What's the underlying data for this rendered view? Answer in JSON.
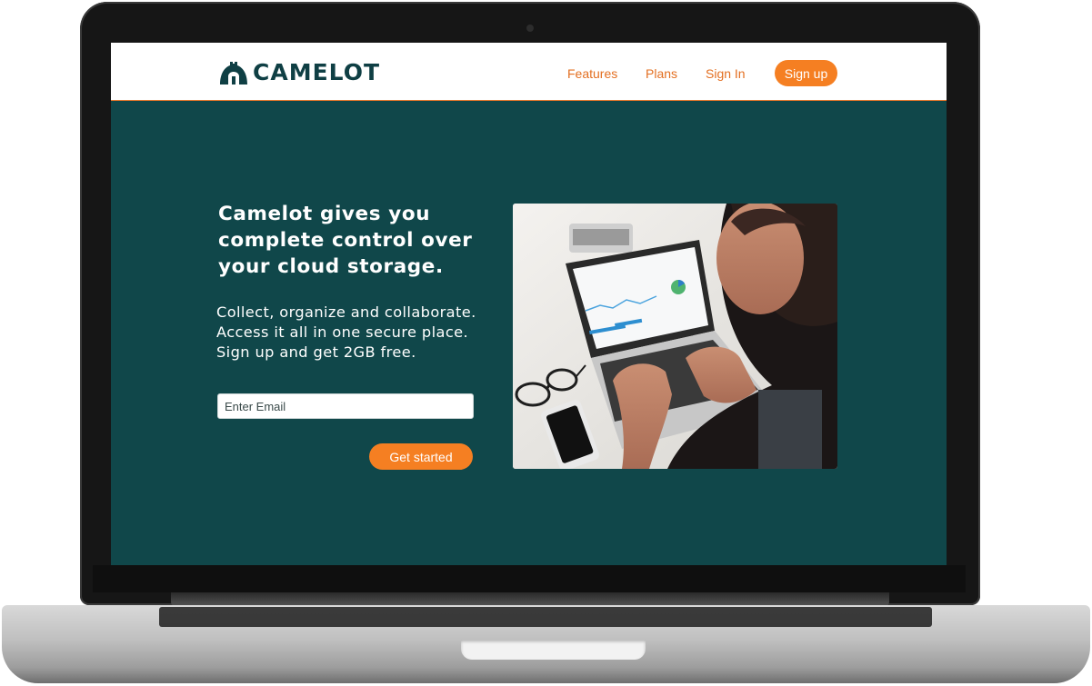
{
  "brand": {
    "name": "CAMELOT",
    "icon": "castle-logo-icon"
  },
  "nav": {
    "links": [
      "Features",
      "Plans",
      "Sign In"
    ],
    "signup_label": "Sign up"
  },
  "hero": {
    "headline": "Camelot gives you complete control over your cloud storage.",
    "subtext": [
      "Collect, organize and collaborate.",
      "Access it all in one secure place.",
      "Sign up and get 2GB free."
    ],
    "email_placeholder": "Enter Email",
    "cta_label": "Get started"
  },
  "colors": {
    "background": "#10474a",
    "accent": "#f57f22",
    "nav_link": "#e36f21",
    "logo": "#0f3f44"
  }
}
